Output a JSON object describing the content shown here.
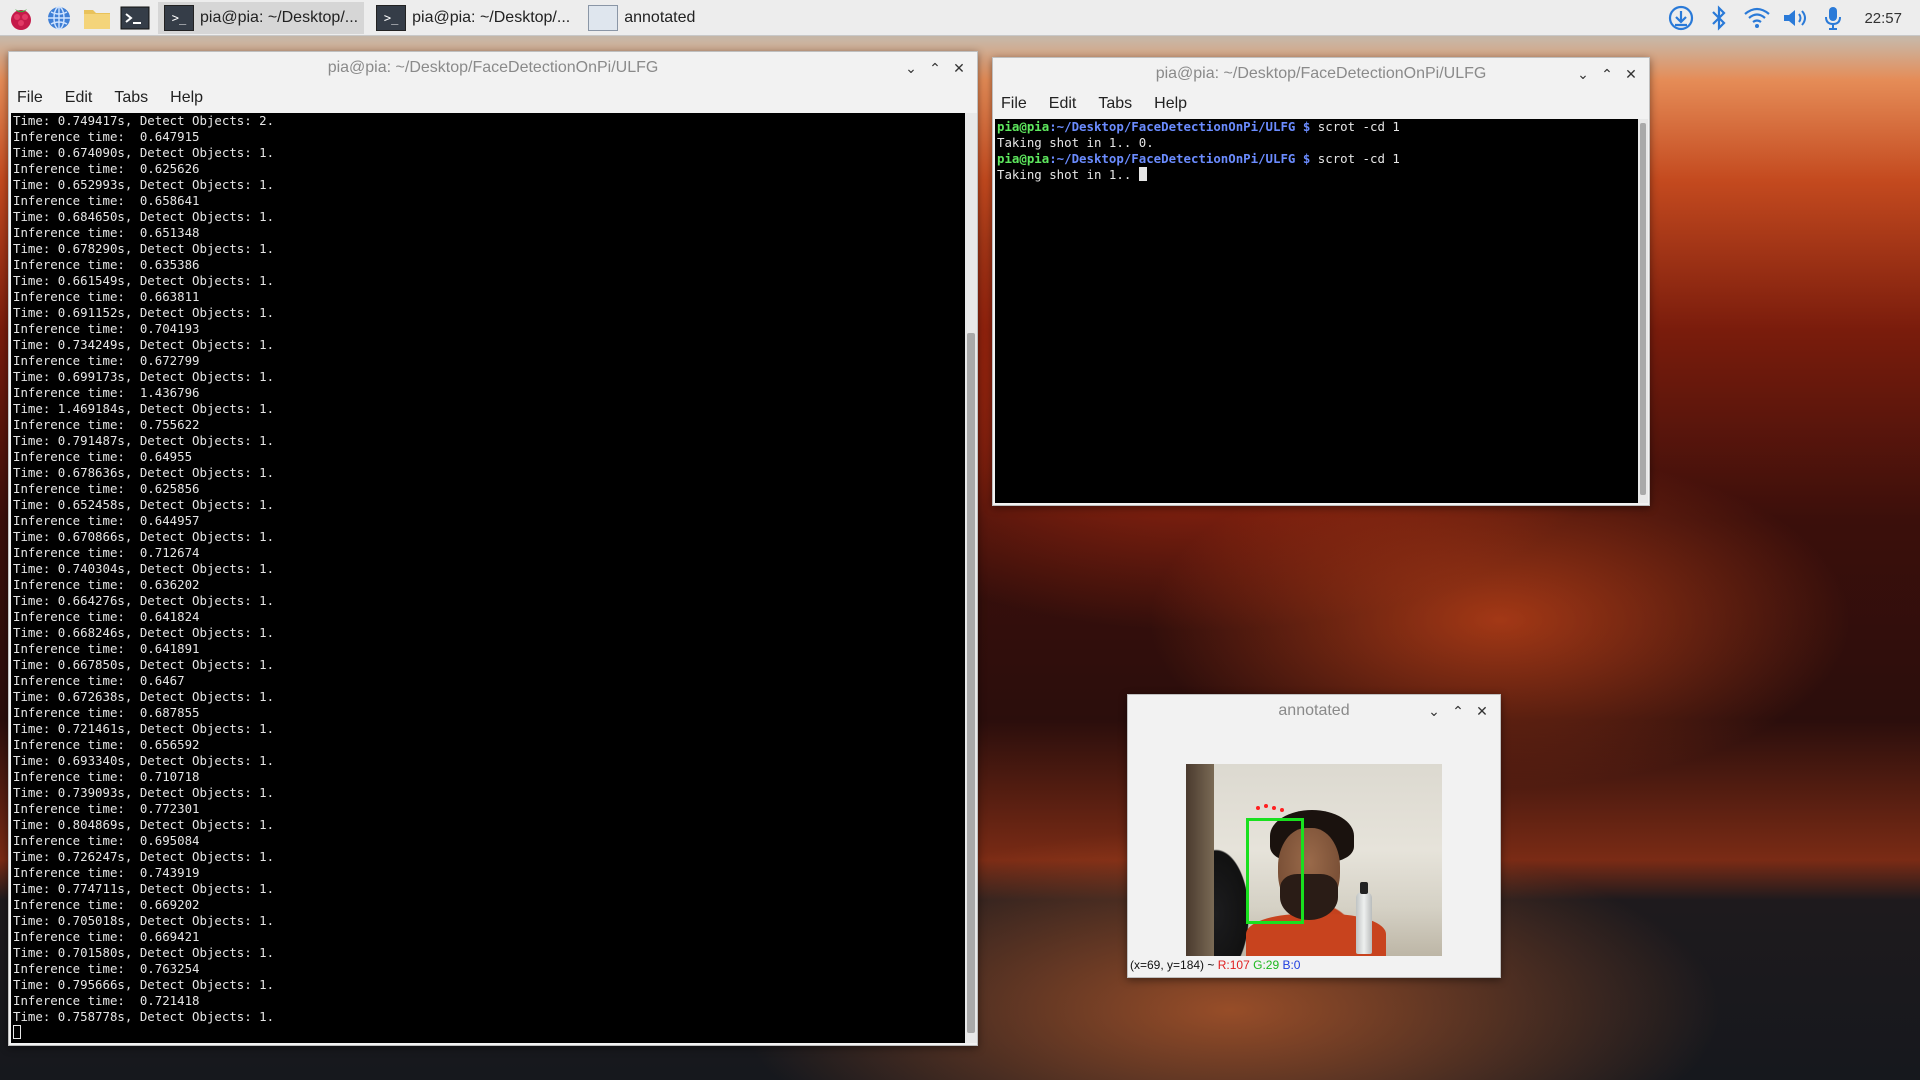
{
  "taskbar": {
    "tasks": [
      {
        "label": "pia@pia: ~/Desktop/...",
        "active": true
      },
      {
        "label": "pia@pia: ~/Desktop/...",
        "active": false
      },
      {
        "label": "annotated",
        "active": false
      }
    ],
    "clock": "22:57"
  },
  "main_terminal": {
    "title": "pia@pia: ~/Desktop/FaceDetectionOnPi/ULFG",
    "menu": [
      "File",
      "Edit",
      "Tabs",
      "Help"
    ],
    "lines": [
      "Time: 0.749417s, Detect Objects: 2.",
      "Inference time:  0.647915",
      "Time: 0.674090s, Detect Objects: 1.",
      "Inference time:  0.625626",
      "Time: 0.652993s, Detect Objects: 1.",
      "Inference time:  0.658641",
      "Time: 0.684650s, Detect Objects: 1.",
      "Inference time:  0.651348",
      "Time: 0.678290s, Detect Objects: 1.",
      "Inference time:  0.635386",
      "Time: 0.661549s, Detect Objects: 1.",
      "Inference time:  0.663811",
      "Time: 0.691152s, Detect Objects: 1.",
      "Inference time:  0.704193",
      "Time: 0.734249s, Detect Objects: 1.",
      "Inference time:  0.672799",
      "Time: 0.699173s, Detect Objects: 1.",
      "Inference time:  1.436796",
      "Time: 1.469184s, Detect Objects: 1.",
      "Inference time:  0.755622",
      "Time: 0.791487s, Detect Objects: 1.",
      "Inference time:  0.64955",
      "Time: 0.678636s, Detect Objects: 1.",
      "Inference time:  0.625856",
      "Time: 0.652458s, Detect Objects: 1.",
      "Inference time:  0.644957",
      "Time: 0.670866s, Detect Objects: 1.",
      "Inference time:  0.712674",
      "Time: 0.740304s, Detect Objects: 1.",
      "Inference time:  0.636202",
      "Time: 0.664276s, Detect Objects: 1.",
      "Inference time:  0.641824",
      "Time: 0.668246s, Detect Objects: 1.",
      "Inference time:  0.641891",
      "Time: 0.667850s, Detect Objects: 1.",
      "Inference time:  0.6467",
      "Time: 0.672638s, Detect Objects: 1.",
      "Inference time:  0.687855",
      "Time: 0.721461s, Detect Objects: 1.",
      "Inference time:  0.656592",
      "Time: 0.693340s, Detect Objects: 1.",
      "Inference time:  0.710718",
      "Time: 0.739093s, Detect Objects: 1.",
      "Inference time:  0.772301",
      "Time: 0.804869s, Detect Objects: 1.",
      "Inference time:  0.695084",
      "Time: 0.726247s, Detect Objects: 1.",
      "Inference time:  0.743919",
      "Time: 0.774711s, Detect Objects: 1.",
      "Inference time:  0.669202",
      "Time: 0.705018s, Detect Objects: 1.",
      "Inference time:  0.669421",
      "Time: 0.701580s, Detect Objects: 1.",
      "Inference time:  0.763254",
      "Time: 0.795666s, Detect Objects: 1.",
      "Inference time:  0.721418",
      "Time: 0.758778s, Detect Objects: 1."
    ]
  },
  "second_terminal": {
    "title": "pia@pia: ~/Desktop/FaceDetectionOnPi/ULFG",
    "menu": [
      "File",
      "Edit",
      "Tabs",
      "Help"
    ],
    "prompt_user": "pia@pia",
    "prompt_path": ":~/Desktop/FaceDetectionOnPi/ULFG",
    "prompt_symbol": " $",
    "command": " scrot -cd 1",
    "output1": "Taking shot in 1.. 0.",
    "output2": "Taking shot in 1.. "
  },
  "annotated": {
    "title": "annotated",
    "status_coords": "(x=69, y=184) ~ ",
    "status_r": "R:107",
    "status_g": "G:29",
    "status_b": "B:0"
  }
}
